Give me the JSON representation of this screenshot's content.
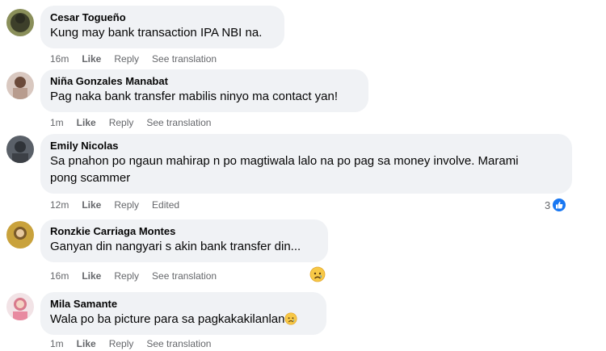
{
  "comments": [
    {
      "author": "Cesar Togueño",
      "text": "Kung may bank transaction IPA NBI na.",
      "time": "16m",
      "like": "Like",
      "reply": "Reply",
      "extra": "See translation"
    },
    {
      "author": "Niña Gonzales Manabat",
      "text": "Pag naka bank transfer mabilis ninyo ma contact yan!",
      "time": "1m",
      "like": "Like",
      "reply": "Reply",
      "extra": "See translation"
    },
    {
      "author": "Emily Nicolas",
      "text_line1": "Sa pnahon po ngaun mahirap n po magtiwala lalo na po pag sa money involve. Marami",
      "text_line2": "pong scammer",
      "time": "12m",
      "like": "Like",
      "reply": "Reply",
      "extra": "Edited",
      "reaction_count": "3"
    },
    {
      "author": "Ronzkie Carriaga Montes",
      "text": "Ganyan din nangyari s akin bank transfer din...",
      "time": "16m",
      "like": "Like",
      "reply": "Reply",
      "extra": "See translation"
    },
    {
      "author": "Mila Samante",
      "text": "Wala po ba picture para sa pagkakakilanlan",
      "time": "1m",
      "like": "Like",
      "reply": "Reply",
      "extra": "See translation"
    }
  ],
  "colors": {
    "bubble": "#f0f2f5",
    "meta": "#65676b",
    "like_blue": "#1877f2"
  },
  "icons": [
    "like-reaction-icon",
    "sad-reaction-icon",
    "sad-emoji-icon"
  ]
}
